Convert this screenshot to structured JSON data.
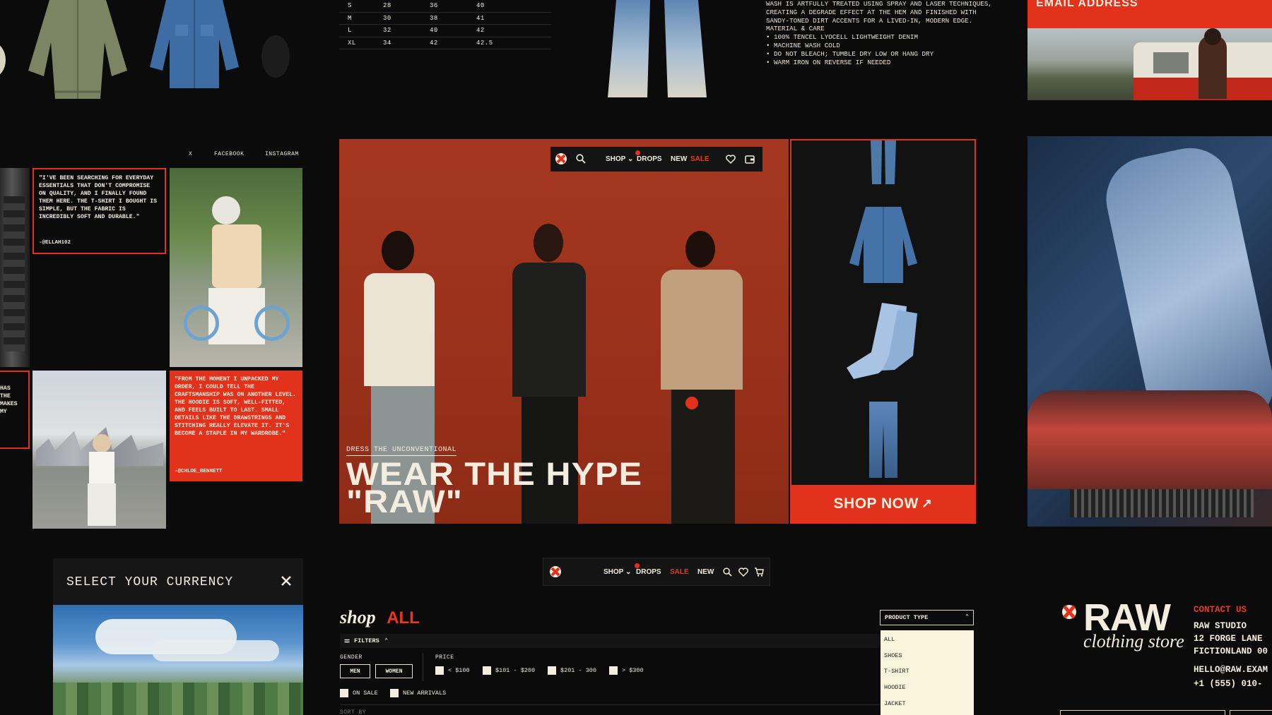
{
  "size_table": {
    "rows": [
      [
        "S",
        "28",
        "36",
        "40"
      ],
      [
        "M",
        "30",
        "38",
        "41"
      ],
      [
        "L",
        "32",
        "40",
        "42"
      ],
      [
        "XL",
        "34",
        "42",
        "42.5"
      ]
    ]
  },
  "product_copy": {
    "description": "WASH IS ARTFULLY TREATED USING SPRAY AND LASER TECHNIQUES, CREATING A DEGRADE EFFECT AT THE HEM AND FINISHED WITH SANDY-TONED DIRT ACCENTS FOR A LIVED-IN, MODERN EDGE.",
    "care_heading": "MATERIAL & CARE",
    "care_items": [
      "• 100% TENCEL LYOCELL LIGHTWEIGHT DENIM",
      "• MACHINE WASH COLD",
      "• DO NOT BLEACH; TUMBLE DRY LOW OR HANG DRY",
      "• WARM IRON ON REVERSE IF NEEDED"
    ]
  },
  "email": {
    "label": "EMAIL ADDRESS"
  },
  "social": {
    "x": "X",
    "facebook": "FACEBOOK",
    "instagram": "INSTAGRAM"
  },
  "testimonials": [
    {
      "quote": "\"I'VE BEEN SEARCHING FOR EVERYDAY ESSENTIALS THAT DON'T COMPROMISE ON QUALITY, AND I FINALLY FOUND THEM HERE. THE T-SHIRT I BOUGHT IS SIMPLE, BUT THE FABRIC IS INCREDIBLY SOFT AND DURABLE.\"",
      "author": "-@ELLAH102"
    },
    {
      "quote": "\"FROM THE MOMENT I UNPACKED MY ORDER, I COULD TELL THE CRAFTSMANSHIP WAS ON ANOTHER LEVEL. THE HOODIE IS SOFT, WELL-FITTED, AND FEELS BUILT TO LAST. SMALL DETAILS LIKE THE DRAWSTRINGS AND STITCHING REALLY ELEVATE IT. IT'S BECOME A STAPLE IN MY WARDROBE.\"",
      "author": "-@CHLOE_BENNETT"
    },
    {
      "quote": "HAS\nTHE\nMAKES\nMY"
    }
  ],
  "nav": {
    "shop": "SHOP",
    "drops": "DROPS",
    "new": "NEW",
    "sale": "SALE"
  },
  "hero": {
    "tagline": "DRESS THE UNCONVENTIONAL",
    "title_line1": "WEAR THE HYPE",
    "title_line2": "\"RAW\""
  },
  "shop_now": {
    "label": "SHOP NOW"
  },
  "currency": {
    "title": "SELECT YOUR CURRENCY"
  },
  "shop_all": {
    "title_prefix": "shop",
    "title_accent": "ALL",
    "filters_label": "FILTERS",
    "gender_label": "GENDER",
    "gender_options": [
      "MEN",
      "WOMEN"
    ],
    "price_label": "PRICE",
    "price_options": [
      "< $100",
      "$101 - $200",
      "$201 - 300",
      "> $300"
    ],
    "toggles": [
      "ON SALE",
      "NEW ARRIVALS"
    ],
    "sort_label": "SORT BY"
  },
  "product_type": {
    "label": "PRODUCT TYPE",
    "options": [
      "ALL",
      "SHOES",
      "T-SHIRT",
      "HOODIE",
      "JACKET"
    ]
  },
  "brand": {
    "name": "RAW",
    "subtitle": "clothing store"
  },
  "contact": {
    "heading": "CONTACT US",
    "studio": "RAW STUDIO",
    "address1": "12 FORGE LANE",
    "address2": "FICTIONLAND 00",
    "email": "HELLO@RAW.EXAM",
    "phone": "+1 (555) 010-"
  },
  "colors": {
    "accent": "#e3321c",
    "background": "#0b0b0b",
    "text": "#f3ede0"
  }
}
